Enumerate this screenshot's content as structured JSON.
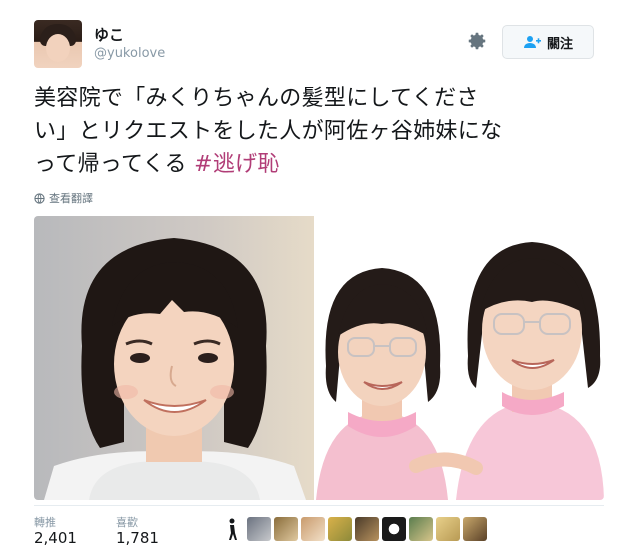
{
  "tweet": {
    "author_name": "ゆこ",
    "author_handle": "@yukolove",
    "follow_label": "關注",
    "text_lines": [
      "美容院で「みくりちゃんの髪型にしてくださ",
      "い」とリクエストをした人が阿佐ヶ谷姉妹にな",
      "って帰ってくる "
    ],
    "hashtag": "#逃げ恥",
    "translate_label": "查看翻譯"
  },
  "stats": {
    "retweets_label": "轉推",
    "retweets_value": "2,401",
    "likes_label": "喜歡",
    "likes_value": "1,781"
  },
  "icons": {
    "settings": "gear-icon",
    "follow": "add-user-icon",
    "translate": "globe-icon",
    "likers_marker": "person-icon"
  },
  "colors": {
    "hashtag": "#b13d77",
    "secondary_text": "#8899a6",
    "button_bg": "#f5f8fa"
  }
}
